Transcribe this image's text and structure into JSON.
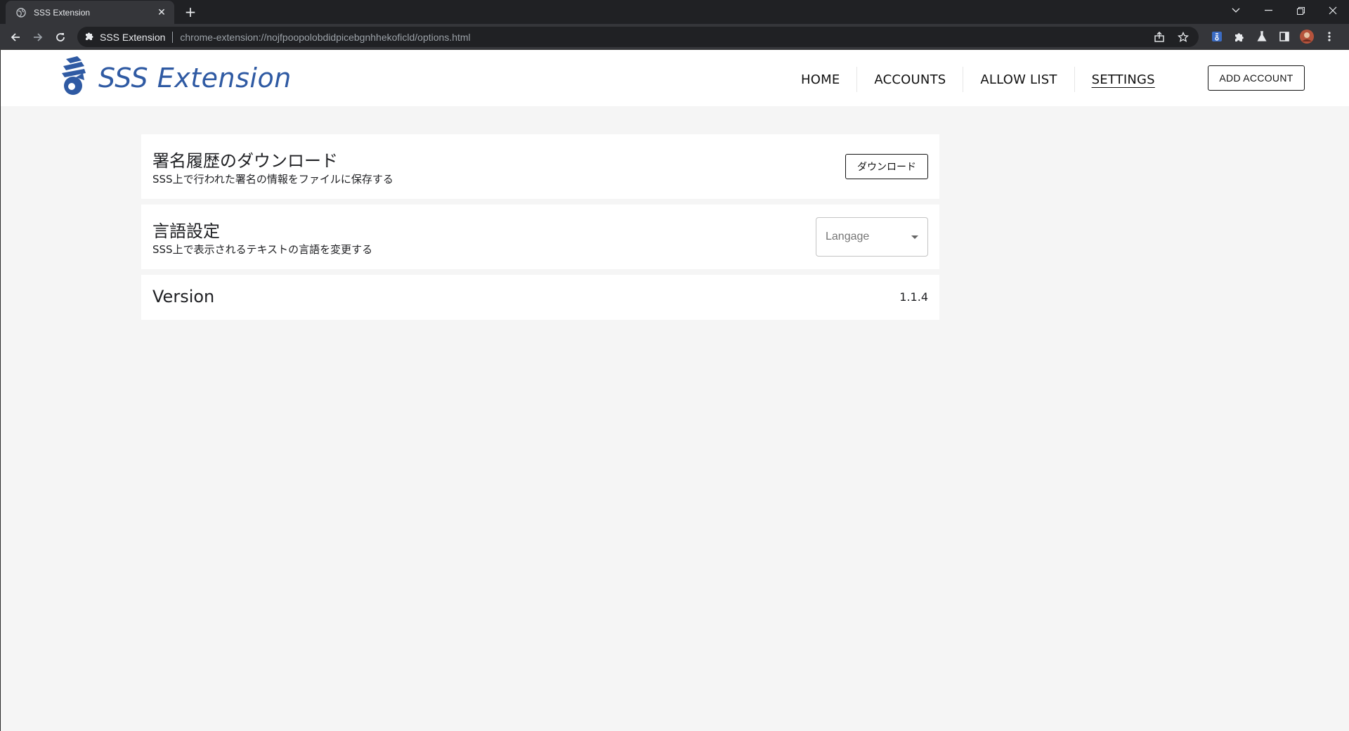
{
  "browser": {
    "tab_title": "SSS Extension",
    "tab_close": "✕",
    "new_tab": "+",
    "site_name": "SSS Extension",
    "url": "chrome-extension://nojfpoopolobdidpicebgnhhekoficld/options.html"
  },
  "header": {
    "logo_text": "SSS Extension",
    "brand_color": "#2f5aa3",
    "nav": {
      "home": "HOME",
      "accounts": "ACCOUNTS",
      "allow_list": "ALLOW LIST",
      "settings": "SETTINGS"
    },
    "active_nav": "SETTINGS",
    "add_account_label": "ADD ACCOUNT"
  },
  "settings": {
    "history": {
      "title": "署名履歴のダウンロード",
      "description": "SSS上で行われた署名の情報をファイルに保存する",
      "button_label": "ダウンロード"
    },
    "language": {
      "title": "言語設定",
      "description": "SSS上で表示されるテキストの言語を変更する",
      "placeholder": "Langage"
    },
    "version": {
      "label": "Version",
      "value": "1.1.4"
    }
  }
}
